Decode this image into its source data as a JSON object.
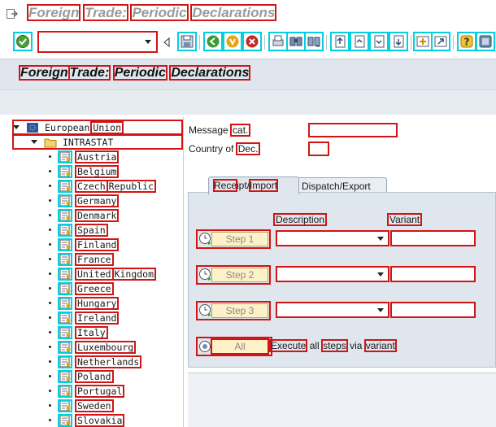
{
  "window": {
    "title_words": [
      "Foreign",
      "Trade:",
      "Periodic",
      "Declarations"
    ]
  },
  "header": {
    "title_words": [
      "Foreign",
      "Trade:",
      "Periodic",
      "Declarations"
    ]
  },
  "toolbar": {
    "command_field_value": "",
    "buttons": [
      "enter-icon",
      "save-icon",
      "back-icon",
      "exit-icon",
      "cancel-icon",
      "print-icon",
      "find-icon",
      "find-next-icon",
      "first-page-icon",
      "previous-page-icon",
      "next-page-icon",
      "last-page-icon",
      "create-session-icon",
      "shortcut-icon",
      "help-icon",
      "settings-icon"
    ]
  },
  "tree": {
    "root": [
      "European",
      "Union"
    ],
    "folder": "INTRASTAT",
    "countries": [
      [
        "Austria"
      ],
      [
        "Belgium"
      ],
      [
        "Czech",
        "Republic"
      ],
      [
        "Germany"
      ],
      [
        "Denmark"
      ],
      [
        "Spain"
      ],
      [
        "Finland"
      ],
      [
        "France"
      ],
      [
        "United",
        "Kingdom"
      ],
      [
        "Greece"
      ],
      [
        "Hungary"
      ],
      [
        "Ireland"
      ],
      [
        "Italy"
      ],
      [
        "Luxembourg"
      ],
      [
        "Netherlands"
      ],
      [
        "Poland"
      ],
      [
        "Portugal"
      ],
      [
        "Sweden"
      ],
      [
        "Slovakia"
      ]
    ]
  },
  "form": {
    "message_cat_label": [
      "Message",
      "cat."
    ],
    "message_cat_value": "",
    "country_dec_label": [
      "Country",
      "of",
      "Dec."
    ],
    "country_dec_value": ""
  },
  "tabs": {
    "receipt": [
      "Rece",
      "ipt/",
      "Import"
    ],
    "dispatch": "Dispatch/Export"
  },
  "steps": {
    "description_header": "Description",
    "variant_header": "Variant",
    "items": [
      {
        "label": "Step 1",
        "description": "",
        "variant": ""
      },
      {
        "label": "Step 2",
        "description": "",
        "variant": ""
      },
      {
        "label": "Step 3",
        "description": "",
        "variant": ""
      }
    ],
    "all_label": "All",
    "all_text_words": [
      "Execute",
      "all",
      "steps",
      "via",
      "variant"
    ]
  },
  "colors": {
    "annotation_red": "#d21414",
    "annotation_cyan": "#00d0e0",
    "header_bg": "#dfe6ee",
    "step_button_bg": "#fdf1c8"
  }
}
